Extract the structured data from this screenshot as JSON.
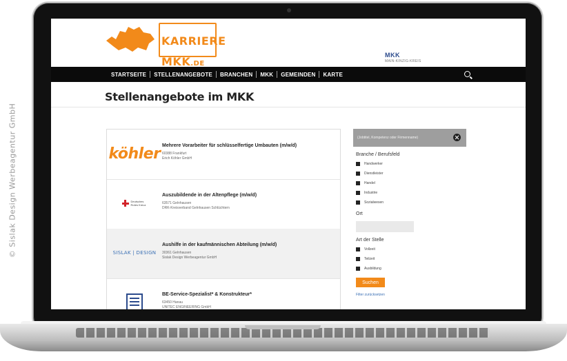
{
  "credit": "© Sislak Design Werbeagentur GmbH",
  "site": {
    "logo_line1": "KARRIERE",
    "logo_line2": "MKK",
    "logo_tld": ".DE",
    "mkk_logo": "MKK",
    "mkk_sub": "MAIN-KINZIG-KREIS"
  },
  "nav": {
    "items": [
      "STARTSEITE",
      "STELLENANGEBOTE",
      "BRANCHEN",
      "MKK",
      "GEMEINDEN",
      "KARTE"
    ]
  },
  "page": {
    "title": "Stellenangebote im MKK"
  },
  "jobs": [
    {
      "logo_text": "köhler",
      "title": "Mehrere Vorarbeiter für schlüsselfertige Umbauten (m/w/d)",
      "location": "60388 Frankfurt",
      "company": "Erich Köhler GmbH"
    },
    {
      "logo_text": "Deutsches Rotes Kreuz",
      "title": "Auszubildende in der Altenpflege (m/w/d)",
      "location": "63571 Gelnhausen",
      "company": "DRK-Kreisverband Gelnhausen Schlüchtern"
    },
    {
      "logo_text": "SISLAK | DESIGN",
      "title": "Aushilfe in der kaufmännischen Abteilung (m/w/d)",
      "location": "30361 Gelnhausen",
      "company": "Sislak Design Werbeagentur GmbH"
    },
    {
      "logo_text": "",
      "title": "BE-Service-Spezialist* & Konstrukteur*",
      "location": "63450 Hanau",
      "company": "UNITEC ENGINEERING GmbH"
    }
  ],
  "filter": {
    "search_placeholder": "(Jobtitel, Kompetenz oder Firmenname)",
    "branch_head": "Branche / Berufsfeld",
    "branches": [
      "Handwerker",
      "Dienstleister",
      "Handel",
      "Industrie",
      "Sozialwesen"
    ],
    "ort_head": "Ort",
    "art_head": "Art der Stelle",
    "arts": [
      "Vollzeit",
      "Teilzeit",
      "Ausbildung"
    ],
    "submit": "Suchen",
    "reset": "Filter zurücksetzen"
  },
  "colors": {
    "brand": "#f28a1a",
    "nav": "#0b0b0b"
  }
}
